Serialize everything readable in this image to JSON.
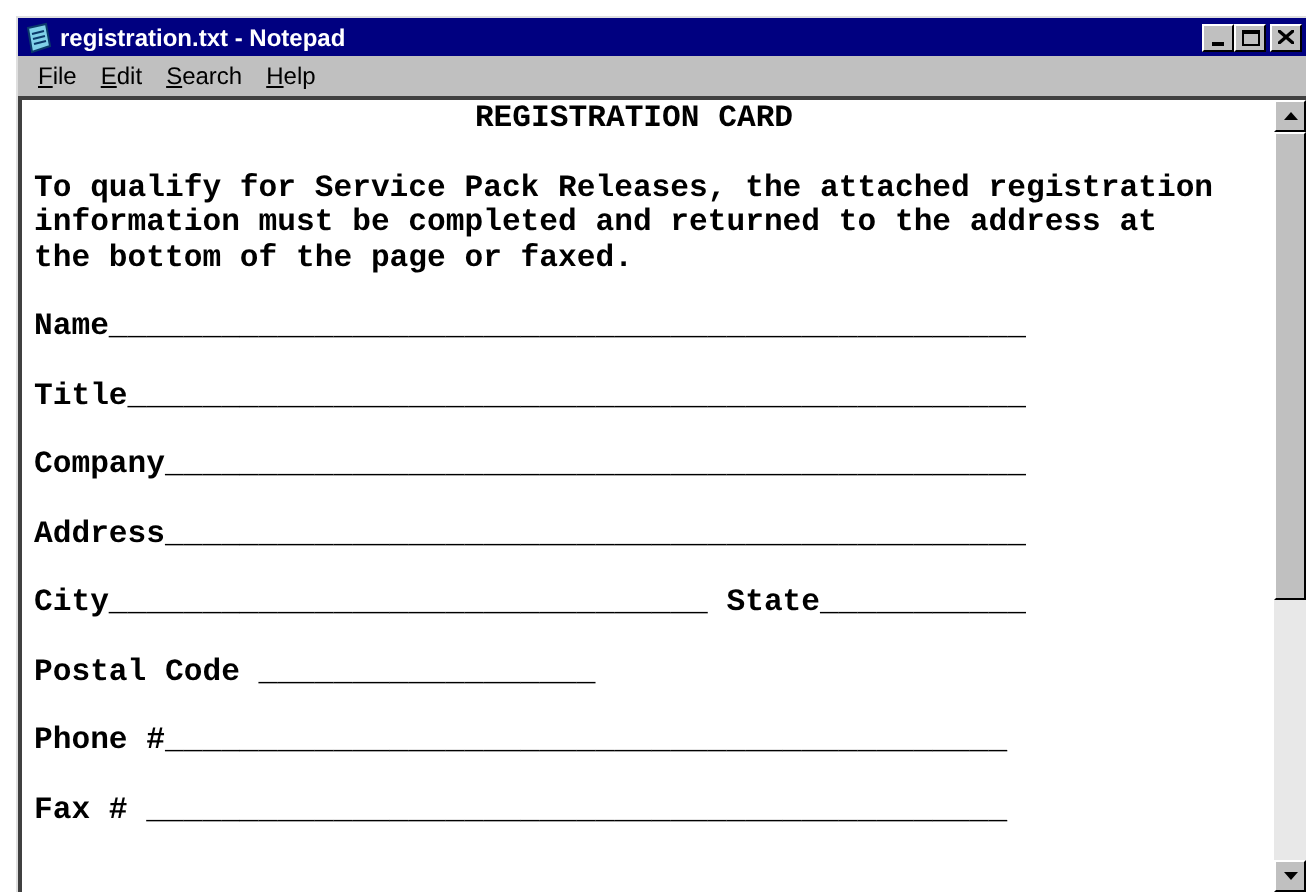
{
  "window": {
    "title": "registration.txt - Notepad"
  },
  "menu": [
    {
      "mnemonic": "F",
      "rest": "ile"
    },
    {
      "mnemonic": "E",
      "rest": "dit"
    },
    {
      "mnemonic": "S",
      "rest": "earch"
    },
    {
      "mnemonic": "H",
      "rest": "elp"
    }
  ],
  "document": [
    {
      "kind": "heading",
      "text": "REGISTRATION CARD"
    },
    {
      "kind": "paragraph",
      "text": "To qualify for Service Pack Releases, the attached registration\ninformation must be completed and returned to the address at\nthe bottom of the page or faxed."
    },
    {
      "kind": "field",
      "text": "Name_________________________________________________"
    },
    {
      "kind": "field",
      "text": "Title________________________________________________"
    },
    {
      "kind": "field",
      "text": "Company______________________________________________"
    },
    {
      "kind": "field",
      "text": "Address______________________________________________"
    },
    {
      "kind": "field",
      "text": "City________________________________ State___________"
    },
    {
      "kind": "field",
      "text": "Postal Code __________________"
    },
    {
      "kind": "field",
      "text": "Phone #_____________________________________________"
    },
    {
      "kind": "field",
      "text": "Fax # ______________________________________________"
    }
  ]
}
